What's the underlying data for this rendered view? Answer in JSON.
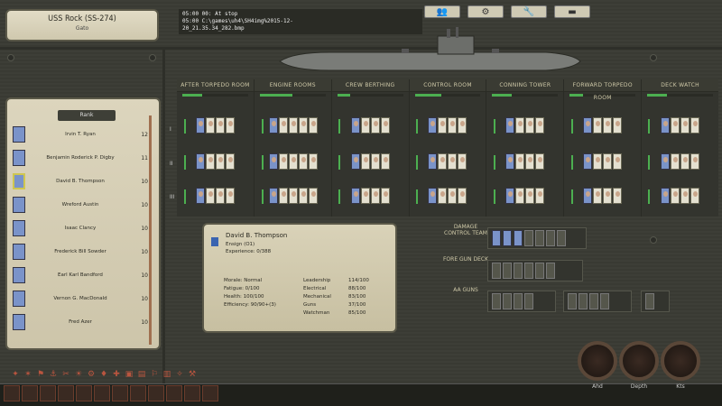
{
  "boat": {
    "title": "USS Rock (SS-274)",
    "subtitle": "Gato"
  },
  "messages": [
    "05:00 00:   At stop",
    "05:00   C:\\games\\uh4\\SH4img%2015-12-",
    "20_21.35.34_282.bmp"
  ],
  "top_buttons": [
    {
      "icon": "crew-icon",
      "glyph": "👥"
    },
    {
      "icon": "settings-icon",
      "glyph": "⚙"
    },
    {
      "icon": "tools-icon",
      "glyph": "🔧"
    },
    {
      "icon": "tab-icon",
      "glyph": "▬"
    }
  ],
  "compartments": [
    {
      "label": "AFTER TORPEDO ROOM",
      "bar": 0.3
    },
    {
      "label": "ENGINE ROOMS",
      "bar": 0.5
    },
    {
      "label": "CREW BERTHING",
      "bar": 0.2
    },
    {
      "label": "CONTROL ROOM",
      "bar": 0.4
    },
    {
      "label": "CONNING TOWER",
      "bar": 0.3
    },
    {
      "label": "FORWARD TORPEDO ROOM",
      "bar": 0.2
    },
    {
      "label": "DECK WATCH",
      "bar": 0.3
    }
  ],
  "watch_rows": [
    "I",
    "II",
    "III"
  ],
  "crew_list": {
    "sort_label": "Rank",
    "members": [
      {
        "name": "Irvin T. Ryan",
        "value": "12"
      },
      {
        "name": "Benjamin Roderick P. Digby",
        "value": "11"
      },
      {
        "name": "David B. Thompson",
        "value": "10"
      },
      {
        "name": "Wreford Austin",
        "value": "10"
      },
      {
        "name": "Isaac Clancy",
        "value": "10"
      },
      {
        "name": "Frederick Bill Sowder",
        "value": "10"
      },
      {
        "name": "Earl Karl Bandford",
        "value": "10"
      },
      {
        "name": "Vernon G. MacDonald",
        "value": "10"
      },
      {
        "name": "Fred Azer",
        "value": "10"
      }
    ]
  },
  "selected": {
    "name": "David B. Thompson",
    "rank": "Ensign (O1)",
    "experience": "Experience: 0/388",
    "stats": [
      {
        "label": "Morale: Normal"
      },
      {
        "label": "Fatigue: 0/100"
      },
      {
        "label": "Health: 100/100"
      },
      {
        "label": "Efficiency: 90/90+(3)"
      }
    ],
    "skills": [
      {
        "label": "Leadership",
        "value": "114/100"
      },
      {
        "label": "Electrical",
        "value": "88/100"
      },
      {
        "label": "Mechanical",
        "value": "83/100"
      },
      {
        "label": "Guns",
        "value": "37/100"
      },
      {
        "label": "Watchman",
        "value": "85/100"
      }
    ]
  },
  "stations": [
    {
      "label": "DAMAGE CONTROL TEAM"
    },
    {
      "label": "FORE GUN DECK"
    },
    {
      "label": "AA GUNS"
    }
  ],
  "gauges": [
    {
      "label": "Ahd"
    },
    {
      "label": "Depth"
    },
    {
      "label": "Kts"
    }
  ]
}
